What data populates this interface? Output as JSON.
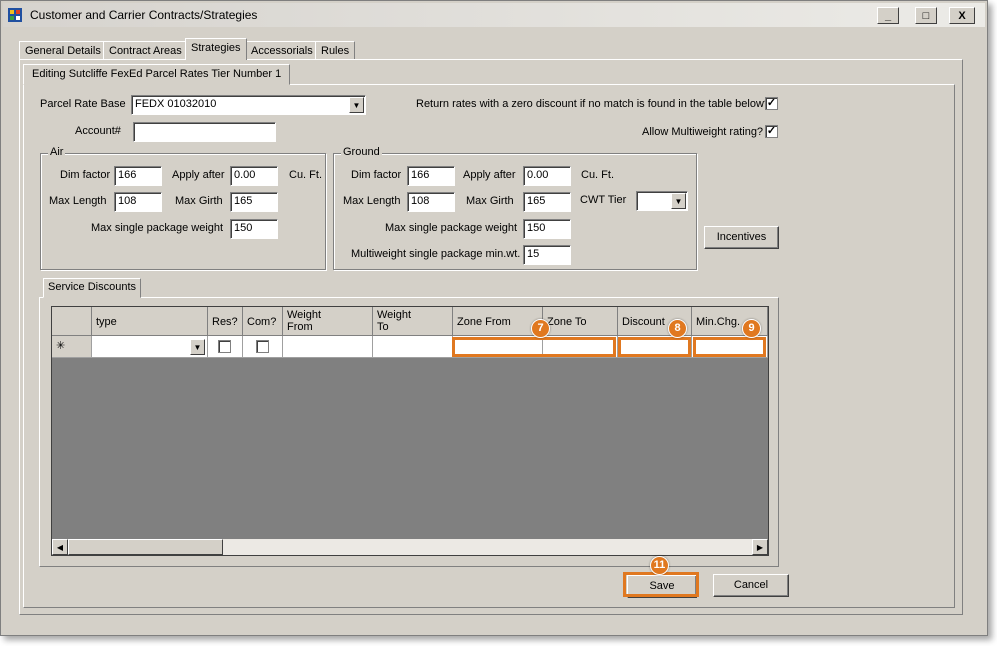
{
  "window": {
    "title": "Customer and Carrier Contracts/Strategies",
    "minimize": "_",
    "maximize": "□",
    "close": "X"
  },
  "tabs": [
    {
      "label": "General Details",
      "active": false
    },
    {
      "label": "Contract Areas",
      "active": false
    },
    {
      "label": "Strategies",
      "active": true
    },
    {
      "label": "Accessorials",
      "active": false
    },
    {
      "label": "Rules",
      "active": false
    }
  ],
  "subtab": {
    "label": "Editing Sutcliffe FexEd Parcel Rates Tier Number 1"
  },
  "form": {
    "parcel_rate_base_label": "Parcel Rate Base",
    "parcel_rate_base_value": "FEDX 01032010",
    "account_label": "Account#",
    "account_value": "",
    "zero_discount_label": "Return rates with a zero discount if no match is found in the table below?",
    "zero_discount_checked": "✓",
    "multiweight_label": "Allow Multiweight rating?",
    "multiweight_checked": "✓"
  },
  "air": {
    "title": "Air",
    "dim_factor_label": "Dim factor",
    "dim_factor": "166",
    "apply_after_label": "Apply after",
    "apply_after": "0.00",
    "unit": "Cu. Ft.",
    "max_length_label": "Max Length",
    "max_length": "108",
    "max_girth_label": "Max Girth",
    "max_girth": "165",
    "max_weight_label": "Max single package weight",
    "max_weight": "150"
  },
  "ground": {
    "title": "Ground",
    "dim_factor_label": "Dim factor",
    "dim_factor": "166",
    "apply_after_label": "Apply after",
    "apply_after": "0.00",
    "unit": "Cu. Ft.",
    "max_length_label": "Max Length",
    "max_length": "108",
    "max_girth_label": "Max Girth",
    "max_girth": "165",
    "cwt_tier_label": "CWT Tier",
    "cwt_tier": "",
    "max_weight_label": "Max single package weight",
    "max_weight": "150",
    "multiweight_min_label": "Multiweight single package min.wt.",
    "multiweight_min": "15"
  },
  "incentives_button": "Incentives",
  "service_discounts": {
    "title": "Service Discounts",
    "columns": [
      "type",
      "Res?",
      "Com?",
      "Weight\nFrom",
      "Weight\nTo",
      "Zone From",
      "Zone To",
      "Discount",
      "Min.Chg."
    ],
    "new_row_marker": "✳"
  },
  "annotations": {
    "zone": "7",
    "discount": "8",
    "minchg": "9",
    "save": "11"
  },
  "annotation_color": "#e07820",
  "buttons": {
    "save": "Save",
    "cancel": "Cancel"
  }
}
